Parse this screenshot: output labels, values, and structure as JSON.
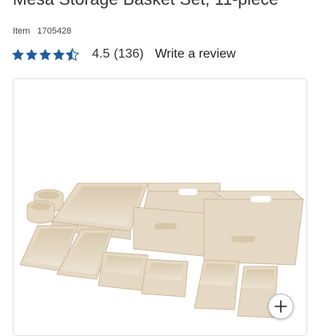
{
  "product": {
    "title": "Mesa Storage Basket Set, 11-piece",
    "item_label": "Item",
    "item_number": "1705428"
  },
  "rating": {
    "value": 4.5,
    "value_text": "4.5",
    "count_text": "(136)",
    "star_color": "#1f5e9c",
    "write_review_label": "Write a review"
  },
  "image": {
    "description_icon": "product-photo",
    "zoom_icon": "plus-icon"
  }
}
